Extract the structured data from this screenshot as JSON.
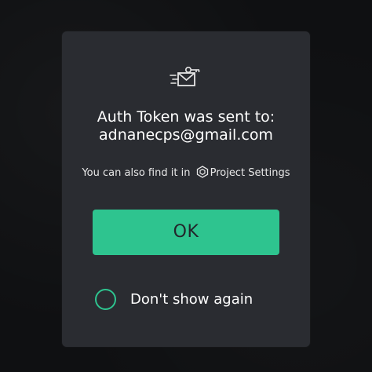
{
  "dialog": {
    "icon": "mail-key-icon",
    "title": "Auth Token was sent to:",
    "email": "adnanecps@gmail.com",
    "hint_prefix": "You can also find it in",
    "hint_icon": "hexagon-settings-icon",
    "hint_link": "Project Settings",
    "ok_label": "OK",
    "dont_show_label": "Don't show again",
    "dont_show_checked": false
  },
  "colors": {
    "accent": "#2ec48f",
    "dialog_bg": "#2a2c31",
    "page_bg": "#0f1012"
  }
}
